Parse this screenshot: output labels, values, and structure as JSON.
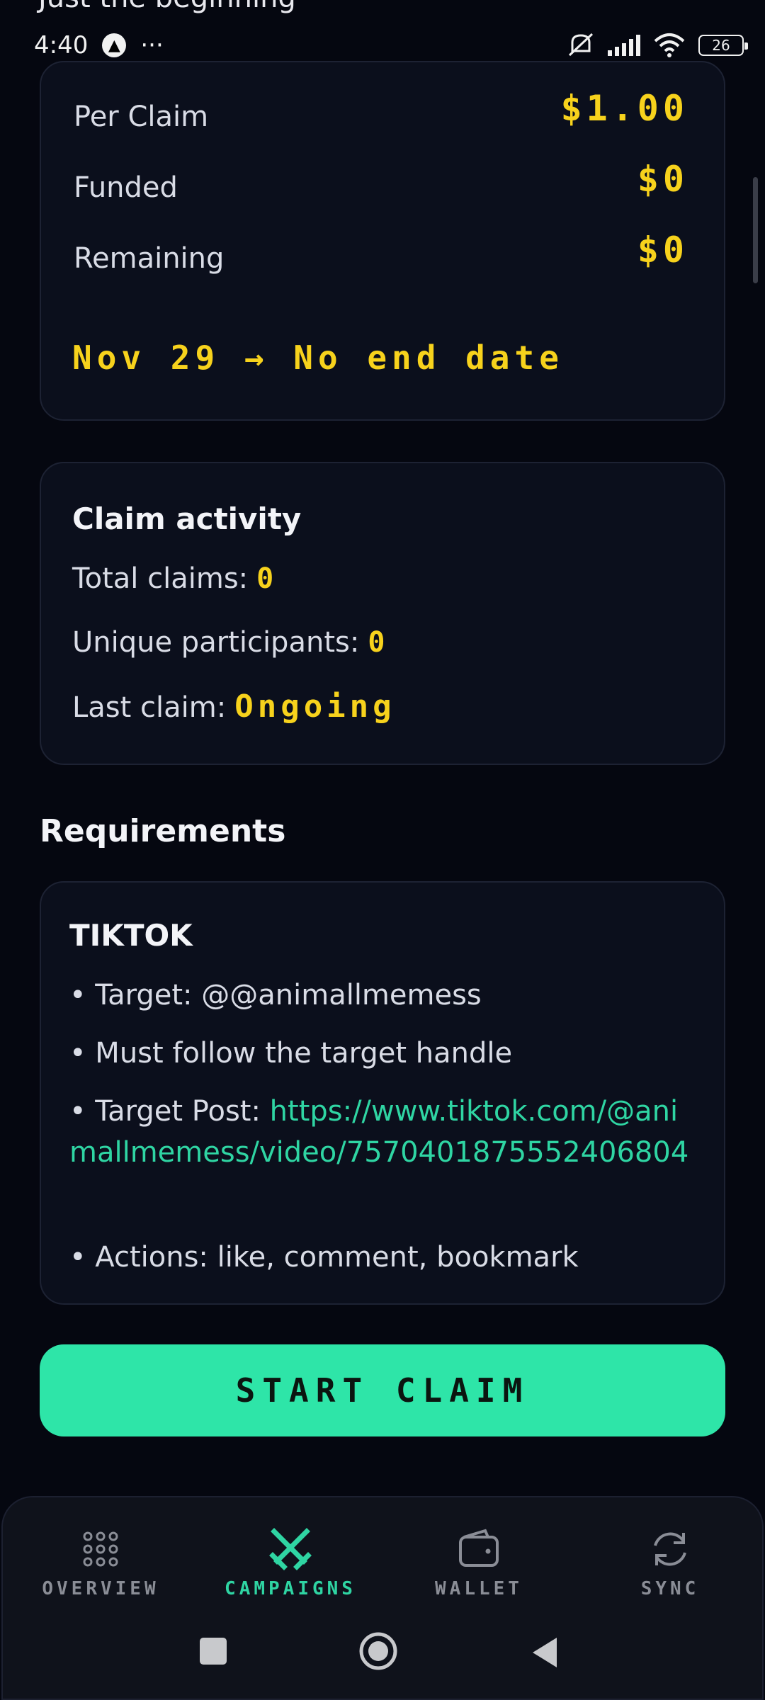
{
  "cut_text": "Just the beginning",
  "status_bar": {
    "time": "4:40",
    "app_icon": "navigation-icon",
    "dots": "···",
    "battery": "26",
    "icons": [
      "mute-icon",
      "signal-icon",
      "wifi-icon",
      "battery-icon"
    ]
  },
  "funding": {
    "rows": [
      {
        "label": "Per Claim",
        "value": "$1.00"
      },
      {
        "label": "Funded",
        "value": "$0"
      },
      {
        "label": "Remaining",
        "value": "$0"
      }
    ],
    "date_range": "Nov 29 → No end date"
  },
  "activity": {
    "heading": "Claim activity",
    "total_claims_label": "Total claims:",
    "total_claims_value": "0",
    "unique_label": "Unique participants:",
    "unique_value": "0",
    "last_claim_label": "Last claim:",
    "last_claim_value": "Ongoing"
  },
  "requirements": {
    "title": "Requirements",
    "platform": "TIKTOK",
    "target": "• Target: @@animallmemess",
    "follow": "• Must follow the target handle",
    "post_label": "• Target Post: ",
    "post_link": "https://www.tiktok.com/@animallmemess/video/7570401875552406804",
    "actions": "• Actions: like, comment, bookmark"
  },
  "start_button": "START CLAIM",
  "bottom_nav": [
    {
      "label": "OVERVIEW",
      "icon": "grid-dots-icon",
      "active": false
    },
    {
      "label": "CAMPAIGNS",
      "icon": "crossed-swords-icon",
      "active": true
    },
    {
      "label": "WALLET",
      "icon": "wallet-icon",
      "active": false
    },
    {
      "label": "SYNC",
      "icon": "sync-icon",
      "active": false
    }
  ],
  "colors": {
    "background": "#050710",
    "card": "#0b0f1c",
    "accent": "#2ee5a8",
    "pixel_yellow": "#f7d21c"
  }
}
